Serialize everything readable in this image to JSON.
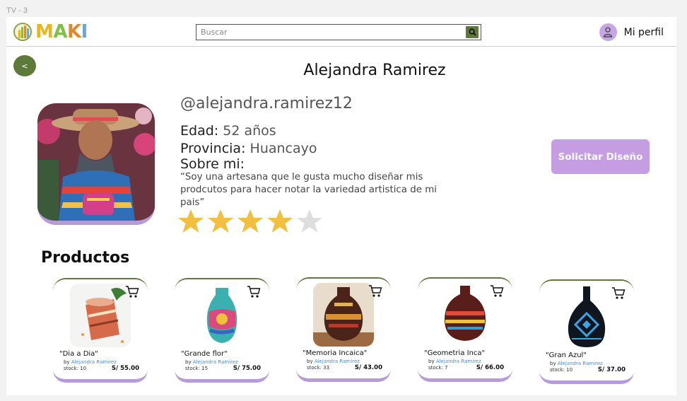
{
  "frame_label": "TV - 3",
  "header": {
    "logo_text": "MAKI",
    "logo_letter_colors": [
      "#e8b624",
      "#7fbf4b",
      "#e08a2c",
      "#6aa7d9"
    ],
    "search_placeholder": "Buscar",
    "profile_label": "Mi perfil"
  },
  "back_label": "<",
  "artisan": {
    "name": "Alejandra Ramirez",
    "username": "@alejandra.ramirez12",
    "age_label": "Edad",
    "age_value": "52 años",
    "province_label": "Provincia",
    "province_value": "Huancayo",
    "about_label": "Sobre mi",
    "bio": "“Soy una artesana que le gusta mucho diseñar mis prodcutos para hacer notar la variedad artistica de mi pais”",
    "rating": 4,
    "rating_max": 5
  },
  "cta_label": "Solicitar Diseño",
  "products_title": "Productos",
  "products": [
    {
      "name": "\"Dia a Dia\"",
      "by_prefix": "by",
      "by_name": "Alejandra Ramirez",
      "stock_label": "stock",
      "stock": "10",
      "price": "S/ 55.00"
    },
    {
      "name": "\"Grande flor\"",
      "by_prefix": "by",
      "by_name": "Alejandra Ramirez",
      "stock_label": "stock",
      "stock": "15",
      "price": "S/ 75.00"
    },
    {
      "name": "\"Memoria Incaica\"",
      "by_prefix": "by",
      "by_name": "Alejandra Ramirez",
      "stock_label": "stock",
      "stock": "33",
      "price": "S/ 43.00"
    },
    {
      "name": "\"Geometria Inca\"",
      "by_prefix": "by",
      "by_name": "Alejandra Ramirez",
      "stock_label": "stock",
      "stock": "7",
      "price": "S/ 66.00"
    },
    {
      "name": "\"Gran Azul\"",
      "by_prefix": "by",
      "by_name": "Alejandra Ramirez",
      "stock_label": "stock",
      "stock": "10",
      "price": "S/ 37.00"
    }
  ],
  "colors": {
    "brand_green": "#5e7a3a",
    "accent_purple": "#c59de3",
    "star_filled": "#f2bf3f",
    "star_empty": "#dedede",
    "link_blue": "#4a8fd6"
  }
}
